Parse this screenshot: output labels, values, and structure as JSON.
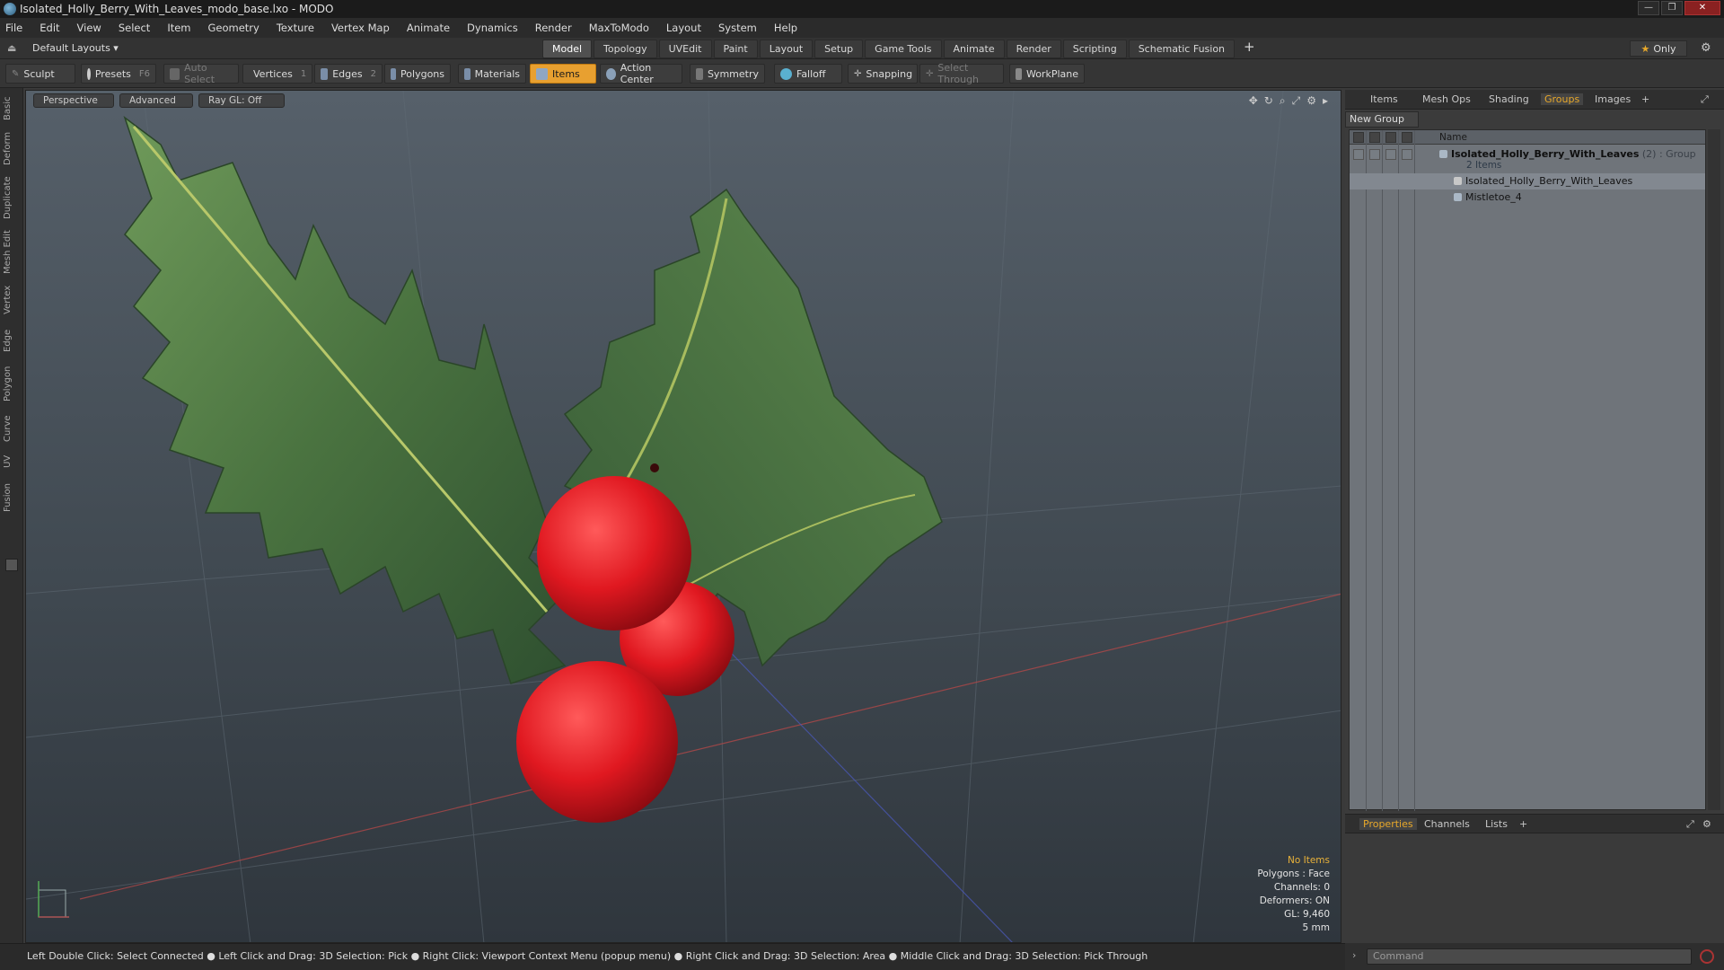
{
  "window": {
    "title": "Isolated_Holly_Berry_With_Leaves_modo_base.lxo - MODO"
  },
  "menu": [
    "File",
    "Edit",
    "View",
    "Select",
    "Item",
    "Geometry",
    "Texture",
    "Vertex Map",
    "Animate",
    "Dynamics",
    "Render",
    "MaxToModo",
    "Layout",
    "System",
    "Help"
  ],
  "layout_bar": {
    "layout_select": "Default Layouts ▾",
    "tabs": [
      "Model",
      "Topology",
      "UVEdit",
      "Paint",
      "Layout",
      "Setup",
      "Game Tools",
      "Animate",
      "Render",
      "Scripting",
      "Schematic Fusion"
    ],
    "active_tab": "Model",
    "add_tab": "+",
    "only_label": "Only"
  },
  "toolbar": {
    "sculpt": "Sculpt",
    "presets": "Presets",
    "presets_key": "F6",
    "auto_select": "Auto Select",
    "vertices": "Vertices",
    "vertices_count": "1",
    "edges": "Edges",
    "edges_count": "2",
    "polygons": "Polygons",
    "materials": "Materials",
    "items": "Items",
    "action_center": "Action Center",
    "symmetry": "Symmetry",
    "falloff": "Falloff",
    "snapping": "Snapping",
    "select_through": "Select Through",
    "workplane": "WorkPlane"
  },
  "left_tabs": [
    "Basic",
    "Deform",
    "Duplicate",
    "Mesh Edit",
    "Vertex",
    "Edge",
    "Polygon",
    "Curve",
    "UV",
    "Fusion"
  ],
  "viewport": {
    "view_mode": "Perspective",
    "shading": "Advanced",
    "raygl": "Ray GL: Off",
    "info": {
      "selection": "No Items",
      "polygons": "Polygons : Face",
      "channels": "Channels: 0",
      "deformers": "Deformers: ON",
      "gl": "GL: 9,460",
      "scale": "5 mm"
    }
  },
  "status_bar": "Left Double Click: Select Connected ● Left Click and Drag: 3D Selection: Pick ● Right Click: Viewport Context Menu (popup menu) ● Right Click and Drag: 3D Selection: Area ● Middle Click and Drag: 3D Selection: Pick Through",
  "right_panel": {
    "tabs": [
      "Items",
      "Mesh Ops",
      "Shading",
      "Groups",
      "Images"
    ],
    "active_tab": "Groups",
    "add_tab": "+",
    "new_group": "New Group",
    "column_name": "Name",
    "group": {
      "name": "Isolated_Holly_Berry_With_Leaves",
      "suffix": " (2) : Group",
      "count": "2 Items",
      "children": [
        "Isolated_Holly_Berry_With_Leaves",
        "Mistletoe_4"
      ]
    }
  },
  "properties_panel": {
    "tabs": [
      "Properties",
      "Channels",
      "Lists"
    ],
    "active_tab": "Properties",
    "add_tab": "+"
  },
  "command": {
    "placeholder": "Command"
  }
}
